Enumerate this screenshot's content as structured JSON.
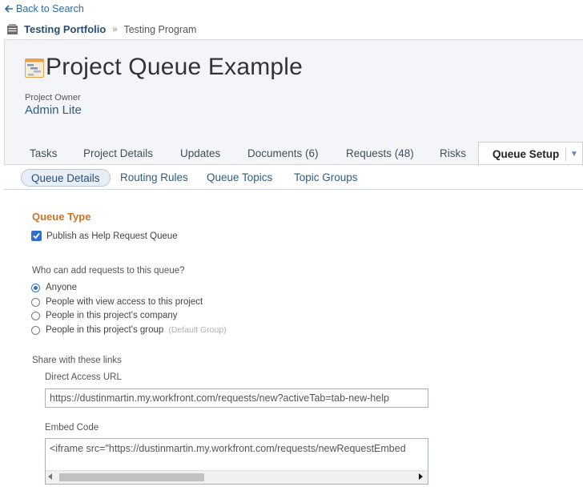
{
  "nav": {
    "back_label": "Back to Search",
    "breadcrumb": {
      "portfolio": "Testing Portfolio",
      "separator": "»",
      "program": "Testing Program"
    }
  },
  "project": {
    "title": "Project Queue Example",
    "owner_label": "Project Owner",
    "owner_name": "Admin Lite"
  },
  "tabs": [
    {
      "label": "Tasks"
    },
    {
      "label": "Project Details"
    },
    {
      "label": "Updates"
    },
    {
      "label": "Documents (6)"
    },
    {
      "label": "Requests (48)"
    },
    {
      "label": "Risks"
    },
    {
      "label": "Queue Setup",
      "active": true
    }
  ],
  "subtabs": [
    {
      "label": "Queue Details",
      "active": true
    },
    {
      "label": "Routing Rules"
    },
    {
      "label": "Queue Topics"
    },
    {
      "label": "Topic Groups"
    }
  ],
  "queue": {
    "section_title": "Queue Type",
    "publish_label": "Publish as Help Request Queue",
    "publish_checked": true,
    "question": "Who can add requests to this queue?",
    "options": [
      {
        "label": "Anyone",
        "selected": true
      },
      {
        "label": "People with view access to this project"
      },
      {
        "label": "People in this project's company"
      },
      {
        "label": "People in this project's group",
        "hint": "(Default Group)"
      }
    ],
    "share_label": "Share with these links",
    "direct_url_label": "Direct Access URL",
    "direct_url_value": "https://dustinmartin.my.workfront.com/requests/new?activeTab=tab-new-help",
    "embed_label": "Embed Code",
    "embed_value": "<iframe src=\"https://dustinmartin.my.workfront.com/requests/newRequestEmbed"
  },
  "colors": {
    "accent": "#2f6fcf",
    "section_title": "#c8742a",
    "link": "#2b5c8a"
  },
  "icons": [
    "back-arrow-icon",
    "portfolio-icon",
    "project-gantt-icon",
    "dropdown-caret-icon"
  ]
}
